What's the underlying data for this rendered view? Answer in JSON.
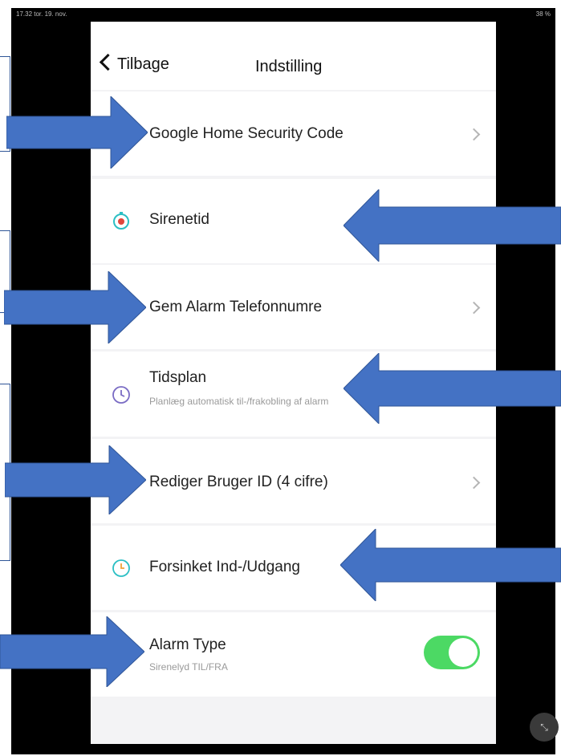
{
  "status": {
    "time": "17.32  tor. 19. nov.",
    "battery": "38 %"
  },
  "nav": {
    "back_label": "Tilbage",
    "title": "Indstilling"
  },
  "rows": {
    "google_home": {
      "label": "Google Home Security Code"
    },
    "sirenetid": {
      "label": "Sirenetid"
    },
    "gem_alarm": {
      "label": "Gem Alarm Telefonnumre"
    },
    "tidsplan": {
      "label": "Tidsplan",
      "sub": "Planlæg automatisk til-/frakobling af alarm"
    },
    "bruger_id": {
      "label": "Rediger Bruger ID (4 cifre)"
    },
    "forsinket": {
      "label": "Forsinket Ind-/Udgang"
    },
    "alarm_type": {
      "label": "Alarm Type",
      "sub": "Sirenelyd TIL/FRA",
      "toggle_on": true
    }
  },
  "colors": {
    "arrow": "#4472c4",
    "toggle": "#4cd964",
    "icon_teal": "#2bbfc4",
    "icon_purple": "#7a6cc4"
  }
}
